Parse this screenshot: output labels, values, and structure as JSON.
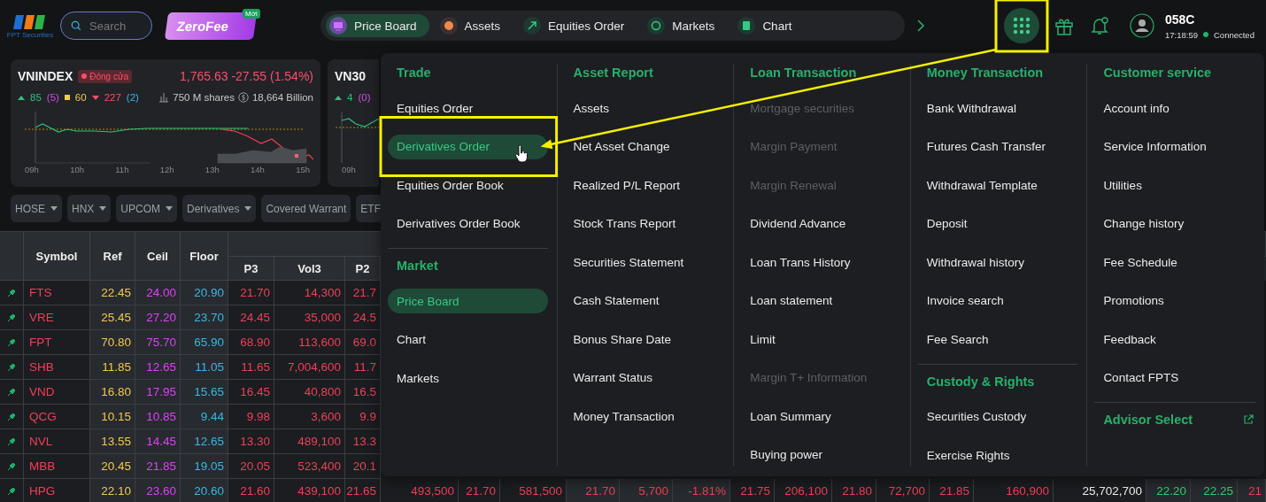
{
  "header": {
    "logo_text": "FPT Securities",
    "search": {
      "placeholder": "Search"
    },
    "promo": {
      "label": "ZeroFee",
      "badge": "Mới"
    },
    "nav": [
      {
        "label": "Price Board",
        "selected": true
      },
      {
        "label": "Assets",
        "selected": false
      },
      {
        "label": "Equities Order",
        "selected": false
      },
      {
        "label": "Markets",
        "selected": false
      },
      {
        "label": "Chart",
        "selected": false
      }
    ],
    "apps_button": {
      "annotated": true
    },
    "account": {
      "id": "058C",
      "time": "17:18:59",
      "connection": "Connected",
      "connected": true
    }
  },
  "indices": [
    {
      "name": "VNINDEX",
      "status": "Đóng cửa",
      "value": "1,765.63",
      "change": "-27.55 (1.54%)",
      "advances": "85",
      "ceilings": "(5)",
      "unchanged": "60",
      "declines": "227",
      "floors": "(2)",
      "volume": "750 M shares",
      "turnover": "18,664 Billion",
      "ticks": [
        "09h",
        "10h",
        "11h",
        "12h",
        "13h",
        "14h",
        "15h"
      ]
    },
    {
      "name": "VN30",
      "advances": "4",
      "ceilings": "(0)",
      "ticks": [
        "09h"
      ]
    }
  ],
  "markets": [
    {
      "label": "HOSE",
      "dropdown": true
    },
    {
      "label": "HNX",
      "dropdown": true
    },
    {
      "label": "UPCOM",
      "dropdown": true
    },
    {
      "label": "Derivatives",
      "dropdown": true
    },
    {
      "label": "Covered Warrant",
      "dropdown": false
    },
    {
      "label": "ETF",
      "dropdown": false
    }
  ],
  "table": {
    "fixed_columns": [
      "Symbol",
      "Ref",
      "Ceil",
      "Floor"
    ],
    "sub_columns": [
      "P3",
      "Vol3",
      "P2"
    ],
    "rows": [
      {
        "symbol": "FTS",
        "falling": true,
        "ref": "22.45",
        "ceil": "24.00",
        "floor": "20.90",
        "cells": [
          "21.70",
          "14,300",
          "21.7"
        ]
      },
      {
        "symbol": "VRE",
        "falling": true,
        "ref": "25.45",
        "ceil": "27.20",
        "floor": "23.70",
        "cells": [
          "24.45",
          "35,000",
          "24.5"
        ]
      },
      {
        "symbol": "FPT",
        "falling": true,
        "ref": "70.80",
        "ceil": "75.70",
        "floor": "65.90",
        "cells": [
          "68.90",
          "113,600",
          "69.0"
        ]
      },
      {
        "symbol": "SHB",
        "falling": true,
        "ref": "11.85",
        "ceil": "12.65",
        "floor": "11.05",
        "cells": [
          "11.65",
          "7,004,600",
          "11.7"
        ]
      },
      {
        "symbol": "VND",
        "falling": true,
        "ref": "16.80",
        "ceil": "17.95",
        "floor": "15.65",
        "cells": [
          "16.45",
          "40,800",
          "16.5"
        ]
      },
      {
        "symbol": "QCG",
        "falling": true,
        "ref": "10.15",
        "ceil": "10.85",
        "floor": "9.44",
        "cells": [
          "9.98",
          "3,600",
          "9.9"
        ]
      },
      {
        "symbol": "NVL",
        "falling": true,
        "ref": "13.55",
        "ceil": "14.45",
        "floor": "12.65",
        "cells": [
          "13.30",
          "489,100",
          "13.3"
        ]
      },
      {
        "symbol": "MBB",
        "falling": true,
        "ref": "20.45",
        "ceil": "21.85",
        "floor": "19.05",
        "cells": [
          "20.05",
          "523,400",
          "20.1"
        ]
      },
      {
        "symbol": "HPG",
        "falling": true,
        "ref": "22.10",
        "ceil": "23.60",
        "floor": "20.60",
        "cells": [
          "21.60",
          "439,100",
          "21.65",
          "493,500",
          "21.70",
          "581,500",
          "21.70",
          "5,700",
          "-1.81%",
          "21.75",
          "206,100",
          "21.80",
          "72,700",
          "21.85",
          "160,900"
        ],
        "extra": [
          {
            "text": "25,702,700",
            "color": "#f0f0f0"
          },
          {
            "text": "22.20",
            "color": "#2dd36f"
          },
          {
            "text": "22.25",
            "color": "#2dd36f"
          },
          {
            "text": "21",
            "color": "#f23f5a"
          }
        ]
      }
    ]
  },
  "menu": {
    "open": true,
    "columns": [
      {
        "sections": [
          {
            "title": "Trade",
            "items": [
              {
                "label": "Equities Order",
                "selected": false
              },
              {
                "label": "Derivatives Order",
                "selected": true,
                "annotated": true
              },
              {
                "label": "Equities Order Book",
                "selected": false
              },
              {
                "label": "Derivatives Order Book",
                "selected": false
              }
            ]
          },
          {
            "title": "Market",
            "items": [
              {
                "label": "Price Board",
                "selected": true
              },
              {
                "label": "Chart",
                "selected": false
              },
              {
                "label": "Markets",
                "selected": false
              }
            ]
          }
        ]
      },
      {
        "sections": [
          {
            "title": "Asset Report",
            "items": [
              {
                "label": "Assets"
              },
              {
                "label": "Net Asset Change"
              },
              {
                "label": "Realized P/L Report"
              },
              {
                "label": "Stock Trans Report"
              },
              {
                "label": "Securities Statement"
              },
              {
                "label": "Cash Statement"
              },
              {
                "label": "Bonus Share Date"
              },
              {
                "label": "Warrant Status"
              },
              {
                "label": "Money Transaction"
              }
            ]
          }
        ]
      },
      {
        "sections": [
          {
            "title": "Loan Transaction",
            "items": [
              {
                "label": "Mortgage securities",
                "disabled": true
              },
              {
                "label": "Margin Payment",
                "disabled": true
              },
              {
                "label": "Margin Renewal",
                "disabled": true
              },
              {
                "label": "Dividend Advance",
                "disabled": false
              },
              {
                "label": "Loan Trans History",
                "disabled": false
              },
              {
                "label": "Loan statement",
                "disabled": false
              },
              {
                "label": "Limit",
                "disabled": false
              },
              {
                "label": "Margin T+ Information",
                "disabled": true
              },
              {
                "label": "Loan Summary",
                "disabled": false
              },
              {
                "label": "Buying power",
                "disabled": false
              }
            ]
          }
        ]
      },
      {
        "sections": [
          {
            "title": "Money Transaction",
            "items": [
              {
                "label": "Bank Withdrawal"
              },
              {
                "label": "Futures Cash Transfer"
              },
              {
                "label": "Withdrawal Template"
              },
              {
                "label": "Deposit"
              },
              {
                "label": "Withdrawal history"
              },
              {
                "label": "Invoice search"
              },
              {
                "label": "Fee Search"
              }
            ]
          },
          {
            "title": "Custody & Rights",
            "items": [
              {
                "label": "Securities Custody"
              },
              {
                "label": "Exercise Rights"
              }
            ]
          }
        ]
      },
      {
        "sections": [
          {
            "title": "Customer service",
            "items": [
              {
                "label": "Account info"
              },
              {
                "label": "Service Information"
              },
              {
                "label": "Utilities"
              },
              {
                "label": "Change history"
              },
              {
                "label": "Fee Schedule"
              },
              {
                "label": "Promotions"
              },
              {
                "label": "Feedback"
              },
              {
                "label": "Contact FPTS"
              }
            ]
          },
          {
            "title": "Advisor Select",
            "kind": "link"
          }
        ]
      }
    ]
  }
}
